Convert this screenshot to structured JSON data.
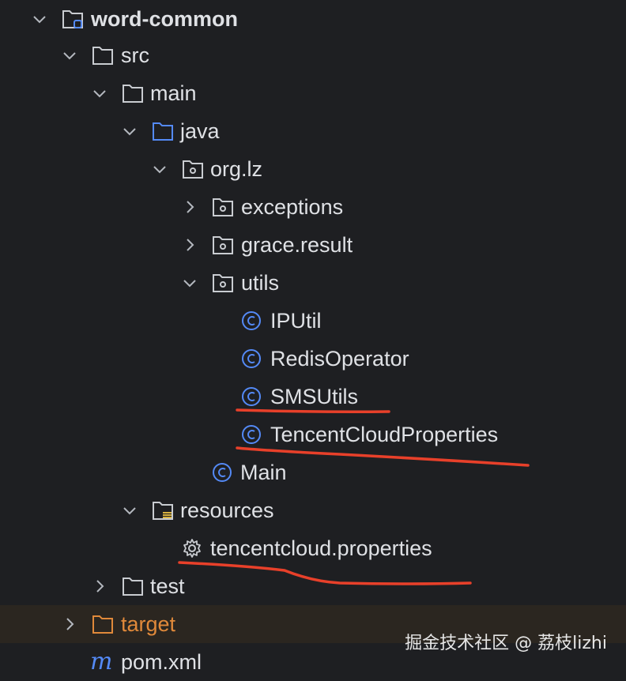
{
  "tree": {
    "root": "word-common",
    "src": "src",
    "main": "main",
    "java": "java",
    "package": "org.lz",
    "exceptions": "exceptions",
    "grace_result": "grace.result",
    "utils": "utils",
    "ip_util": "IPUtil",
    "redis_operator": "RedisOperator",
    "sms_utils": "SMSUtils",
    "tencent_props_class": "TencentCloudProperties",
    "main_class": "Main",
    "resources": "resources",
    "props_file": "tencentcloud.properties",
    "test": "test",
    "target": "target",
    "pom": "pom.xml"
  },
  "icons": {
    "class_icon": "class-c-icon",
    "folder": "folder-icon",
    "package": "package-icon",
    "settings_file": "gear-icon",
    "maven": "maven-m-icon"
  },
  "colors": {
    "background": "#1e1f22",
    "text": "#dfe1e5",
    "class_blue": "#548af7",
    "excluded_orange": "#e0893a",
    "annotation_red": "#e8402a"
  },
  "watermark": "掘金技术社区 @ 荔枝lizhi"
}
